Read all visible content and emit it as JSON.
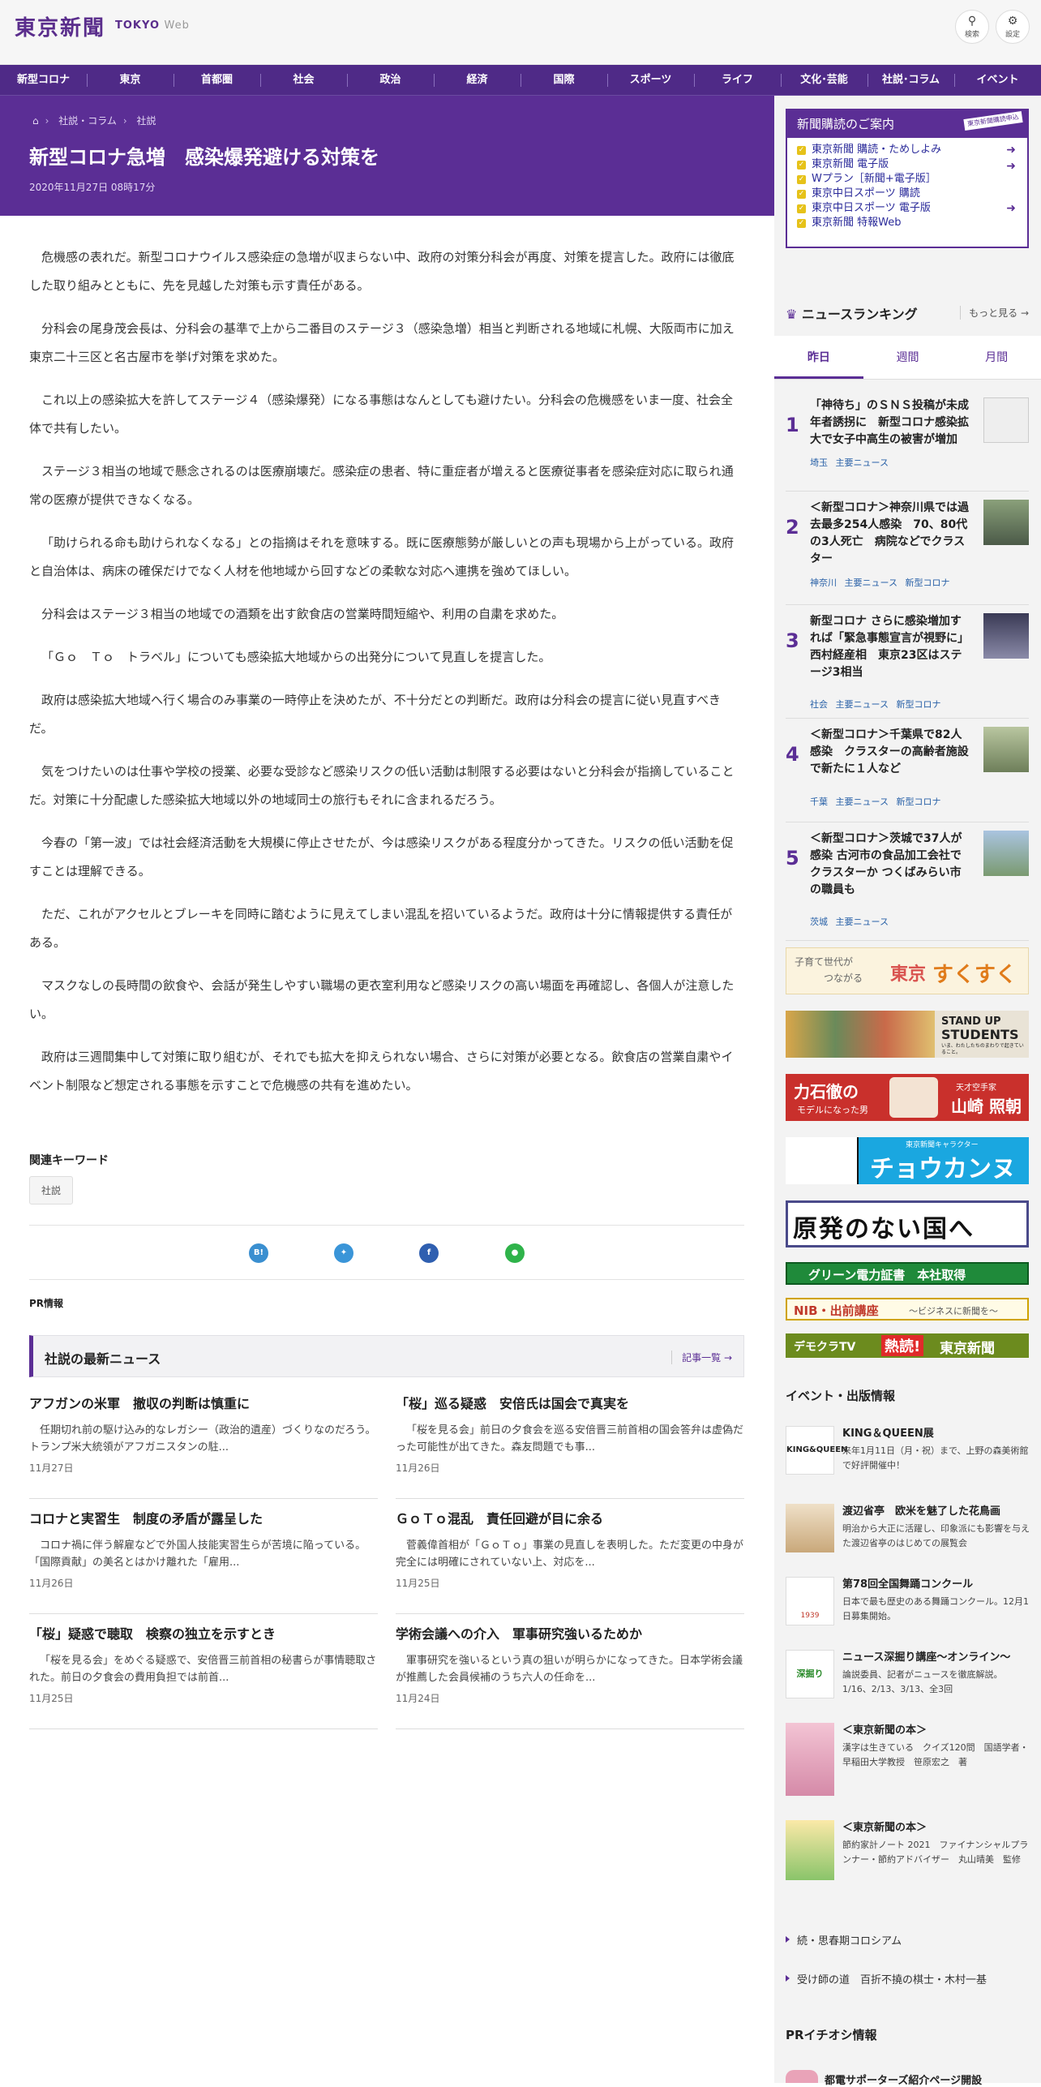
{
  "header": {
    "logo": "東京新聞",
    "logo_sub": "TOKYO",
    "logo_web": "Web",
    "search_label": "検索",
    "settings_label": "設定"
  },
  "nav": [
    "新型コロナ",
    "東京",
    "首都圏",
    "社会",
    "政治",
    "経済",
    "国際",
    "スポーツ",
    "ライフ",
    "文化･芸能",
    "社説･コラム",
    "イベント"
  ],
  "breadcrumb": [
    "社説・コラム",
    "社説"
  ],
  "article": {
    "title": "新型コロナ急増　感染爆発避ける対策を",
    "date": "2020年11月27日 08時17分",
    "paragraphs": [
      "危機感の表れだ。新型コロナウイルス感染症の急増が収まらない中、政府の対策分科会が再度、対策を提言した。政府には徹底した取り組みとともに、先を見越した対策も示す責任がある。",
      "分科会の尾身茂会長は、分科会の基準で上から二番目のステージ３（感染急増）相当と判断される地域に札幌、大阪両市に加え東京二十三区と名古屋市を挙げ対策を求めた。",
      "これ以上の感染拡大を許してステージ４（感染爆発）になる事態はなんとしても避けたい。分科会の危機感をいま一度、社会全体で共有したい。",
      "ステージ３相当の地域で懸念されるのは医療崩壊だ。感染症の患者、特に重症者が増えると医療従事者を感染症対応に取られ通常の医療が提供できなくなる。",
      "「助けられる命も助けられなくなる」との指摘はそれを意味する。既に医療態勢が厳しいとの声も現場から上がっている。政府と自治体は、病床の確保だけでなく人材を他地域から回すなどの柔軟な対応へ連携を強めてほしい。",
      "分科会はステージ３相当の地域での酒類を出す飲食店の営業時間短縮や、利用の自粛を求めた。",
      "「Ｇｏ　Ｔｏ　トラベル」についても感染拡大地域からの出発分について見直しを提言した。",
      "政府は感染拡大地域へ行く場合のみ事業の一時停止を決めたが、不十分だとの判断だ。政府は分科会の提言に従い見直すべきだ。",
      "気をつけたいのは仕事や学校の授業、必要な受診など感染リスクの低い活動は制限する必要はないと分科会が指摘していることだ。対策に十分配慮した感染拡大地域以外の地域同士の旅行もそれに含まれるだろう。",
      "今春の「第一波」では社会経済活動を大規模に停止させたが、今は感染リスクがある程度分かってきた。リスクの低い活動を促すことは理解できる。",
      "ただ、これがアクセルとブレーキを同時に踏むように見えてしまい混乱を招いているようだ。政府は十分に情報提供する責任がある。",
      "マスクなしの長時間の飲食や、会話が発生しやすい職場の更衣室利用など感染リスクの高い場面を再確認し、各個人が注意したい。",
      "政府は三週間集中して対策に取り組むが、それでも拡大を抑えられない場合、さらに対策が必要となる。飲食店の営業自粛やイベント制限など想定される事態を示すことで危機感の共有を進めたい。"
    ]
  },
  "keywords": {
    "title": "関連キーワード",
    "tags": [
      "社説"
    ]
  },
  "pr_label": "PR情報",
  "latest": {
    "title": "社説の最新ニュース",
    "more": "記事一覧",
    "items": [
      {
        "h": "アフガンの米軍　撤収の判断は慎重に",
        "b": "任期切れ前の駆け込み的なレガシー（政治的遺産）づくりなのだろう。トランプ米大統領がアフガニスタンの駐...",
        "d": "11月27日"
      },
      {
        "h": "「桜」巡る疑惑　安倍氏は国会で真実を",
        "b": "「桜を見る会」前日の夕食会を巡る安倍晋三前首相の国会答弁は虚偽だった可能性が出てきた。森友問題でも事...",
        "d": "11月26日"
      },
      {
        "h": "コロナと実習生　制度の矛盾が露呈した",
        "b": "コロナ禍に伴う解雇などで外国人技能実習生らが苦境に陥っている。「国際貢献」の美名とはかけ離れた「雇用...",
        "d": "11月26日"
      },
      {
        "h": "ＧｏＴｏ混乱　責任回避が目に余る",
        "b": "菅義偉首相が「ＧｏＴｏ」事業の見直しを表明した。ただ変更の中身が完全には明確にされていない上、対応を...",
        "d": "11月25日"
      },
      {
        "h": "「桜」疑惑で聴取　検察の独立を示すとき",
        "b": "「桜を見る会」をめぐる疑惑で、安倍晋三前首相の秘書らが事情聴取された。前日の夕食会の費用負担では前首...",
        "d": "11月25日"
      },
      {
        "h": "学術会議への介入　軍事研究強いるためか",
        "b": "軍事研究を強いるという真の狙いが明らかになってきた。日本学術会議が推薦した会員候補のうち六人の任命を...",
        "d": "11月24日"
      }
    ]
  },
  "subscribe": {
    "title": "新聞購読のご案内",
    "badge": "東京新聞購読申込",
    "items": [
      "東京新聞 購読・ためしよみ",
      "東京新聞 電子版",
      "Wプラン［新聞+電子版］",
      "東京中日スポーツ 購読",
      "東京中日スポーツ 電子版",
      "東京新聞 特報Web"
    ]
  },
  "ranking": {
    "title": "ニュースランキング",
    "more": "もっと見る",
    "tabs": [
      "昨日",
      "週間",
      "月間"
    ],
    "items": [
      {
        "n": "1",
        "h": "「神待ち」のＳＮＳ投稿が未成年者誘拐に　新型コロナ感染拡大で女子中高生の被害が増加",
        "tags": "埼玉 主要ニュース"
      },
      {
        "n": "2",
        "h": "＜新型コロナ＞神奈川県では過去最多254人感染　70、80代の3人死亡　病院などでクラスター",
        "tags": "神奈川 主要ニュース 新型コロナ"
      },
      {
        "n": "3",
        "h": "新型コロナ さらに感染増加すれば「緊急事態宣言が視野に」西村経産相　東京23区はステージ3相当",
        "tags": "社会 主要ニュース 新型コロナ"
      },
      {
        "n": "4",
        "h": "＜新型コロナ＞千葉県で82人感染　クラスターの高齢者施設で新たに１人など",
        "tags": "千葉 主要ニュース 新型コロナ"
      },
      {
        "n": "5",
        "h": "＜新型コロナ＞茨城で37人が感染 古河市の食品加工会社でクラスターか つくばみらい市の職員も",
        "tags": "茨城 主要ニュース"
      }
    ]
  },
  "banners": {
    "sukusuku": {
      "a": "子育て世代が",
      "b": "つながる",
      "c": "東京",
      "d": "すくすく"
    },
    "students": {
      "a": "STAND UP",
      "b": "STUDENTS",
      "c": "いま、わたしたちのまわりで起きていること。"
    },
    "yamazaki": {
      "a": "力石徹の",
      "b": "モデルになった男",
      "c": "天才空手家",
      "d": "山崎 照朝"
    },
    "chou": {
      "a": "東京新聞キャラクター",
      "b": "チョウカンヌ"
    },
    "genpatsu": "原発のない国へ",
    "green": "グリーン電力証書　本社取得",
    "nib": {
      "a": "NIB・出前講座",
      "b": "〜ビジネスに新聞を〜"
    },
    "democra": {
      "a": "デモクラTV",
      "b": "熱読!",
      "c": "東京新聞"
    }
  },
  "events": {
    "title": "イベント・出版情報",
    "items": [
      {
        "h": "KING＆QUEEN展",
        "s": "来年1月11日（月・祝）まで、上野の森美術館で好評開催中！"
      },
      {
        "h": "渡辺省亭　欧米を魅了した花鳥画",
        "s": "明治から大正に活躍し、印象派にも影響を与えた渡辺省亭のはじめての展覧会"
      },
      {
        "h": "第78回全国舞踊コンクール",
        "s": "日本で最も歴史のある舞踊コンクール。12月1日募集開始。"
      },
      {
        "h": "ニュース深掘り講座～オンライン～",
        "s": "論説委員、記者がニュースを徹底解説。1/16、2/13、3/13、全3回"
      },
      {
        "h": "＜東京新聞の本＞",
        "s": "漢字は生きている　クイズ120問　国語学者・早稲田大学教授　笹原宏之　著"
      },
      {
        "h": "＜東京新聞の本＞",
        "s": "節約家計ノート 2021　ファイナンシャルプランナー・節約アドバイザー　丸山晴美　監修"
      }
    ],
    "thumb_text": {
      "kq": "KING&QUEEN",
      "year": "1939",
      "fukabori": "深掘り"
    }
  },
  "links": [
    "続・思春期コロシアム",
    "受け師の道　百折不撓の棋士・木村一基"
  ],
  "pr_pick": {
    "title": "PRイチオシ情報",
    "item": "都電サポーターズ紹介ページ開設"
  },
  "colors": {
    "brand": "#5b2e95",
    "nav": "#4f2a87",
    "link": "#2a62a8"
  }
}
